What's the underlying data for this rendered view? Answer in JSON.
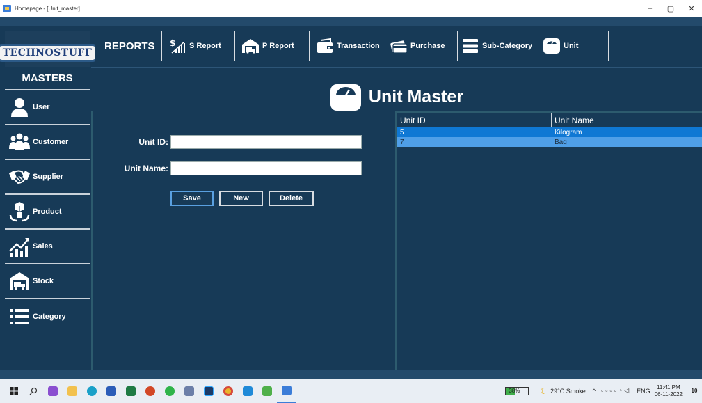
{
  "window": {
    "title": "Homepage - [Unit_master]",
    "minimize": "–",
    "maximize": "▢",
    "close": "✕"
  },
  "logo": {
    "text": "TECHNOSTUFF"
  },
  "reports": {
    "title": "REPORTS",
    "buttons": [
      {
        "label": "S Report",
        "icon": "sales-report-icon"
      },
      {
        "label": "P Report",
        "icon": "truck-warehouse-icon"
      },
      {
        "label": "Transaction",
        "icon": "wallet-icon"
      },
      {
        "label": "Purchase",
        "icon": "card-icon"
      },
      {
        "label": "Sub-Category",
        "icon": "list-icon"
      },
      {
        "label": "Unit",
        "icon": "scale-icon"
      }
    ]
  },
  "sidebar": {
    "title": "MASTERS",
    "items": [
      {
        "label": "User",
        "icon": "user-icon"
      },
      {
        "label": "Customer",
        "icon": "customers-icon"
      },
      {
        "label": "Supplier",
        "icon": "handshake-icon"
      },
      {
        "label": "Product",
        "icon": "product-icon"
      },
      {
        "label": "Sales",
        "icon": "sales-icon"
      },
      {
        "label": "Stock",
        "icon": "stock-icon"
      },
      {
        "label": "Category",
        "icon": "category-icon"
      }
    ]
  },
  "header": {
    "title": "Unit Master",
    "icon": "scale-icon"
  },
  "form": {
    "unit_id_label": "Unit ID:",
    "unit_id_value": "",
    "unit_name_label": "Unit Name:",
    "unit_name_value": "",
    "save_label": "Save",
    "new_label": "New",
    "delete_label": "Delete"
  },
  "grid": {
    "columns": [
      "Unit ID",
      "Unit Name"
    ],
    "rows": [
      {
        "id": "5",
        "name": "Kilogram",
        "selected": true
      },
      {
        "id": "7",
        "name": "Bag",
        "selected": false
      }
    ]
  },
  "taskbar": {
    "battery": "38%",
    "battery_level": 0.38,
    "weather": "29°C Smoke",
    "lang": "ENG",
    "time": "11:41 PM",
    "date": "06-11-2022",
    "notification_count": "10"
  },
  "colors": {
    "app_bg": "#173a57",
    "selected_row": "#0f78d4",
    "alt_row": "#4f9fe8"
  }
}
